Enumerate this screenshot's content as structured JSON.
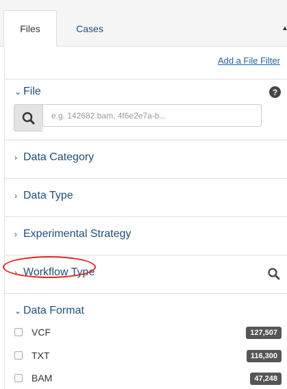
{
  "tabs": [
    {
      "label": "Files",
      "active": true
    },
    {
      "label": "Cases",
      "active": false
    }
  ],
  "add_filter_label": "Add a File Filter",
  "file_section": {
    "label": "File",
    "search_placeholder": "e.g. 142682.bam, 4f6e2e7a-b...",
    "help_symbol": "?"
  },
  "collapsed_sections": [
    {
      "label": "Data Category"
    },
    {
      "label": "Data Type"
    },
    {
      "label": "Experimental Strategy"
    },
    {
      "label": "Workflow Type"
    }
  ],
  "data_format": {
    "label": "Data Format",
    "highlighted": true,
    "items": [
      {
        "label": "VCF",
        "count": "127,507"
      },
      {
        "label": "TXT",
        "count": "116,300"
      },
      {
        "label": "BAM",
        "count": "47,248"
      }
    ]
  },
  "colors": {
    "link": "#1f4e79",
    "badge": "#555555",
    "highlight": "#e0201e"
  },
  "icons": [
    "search-icon",
    "help-icon",
    "chevron-right-icon",
    "chevron-down-icon"
  ]
}
